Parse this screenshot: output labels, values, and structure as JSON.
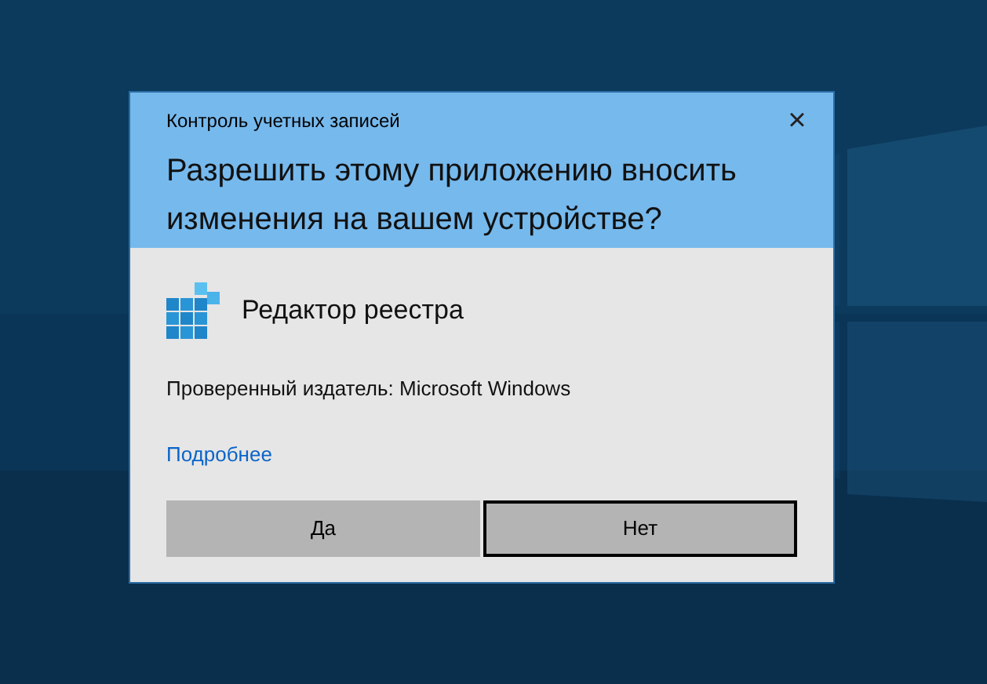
{
  "window": {
    "title": "Контроль учетных записей",
    "close": "×"
  },
  "question": "Разрешить этому приложению вносить изменения на вашем устройстве?",
  "app": {
    "name": "Редактор реестра"
  },
  "publisher": "Проверенный издатель: Microsoft Windows",
  "details_link": "Подробнее",
  "buttons": [
    {
      "label": "Да",
      "focused": false
    },
    {
      "label": "Нет",
      "focused": true
    }
  ]
}
